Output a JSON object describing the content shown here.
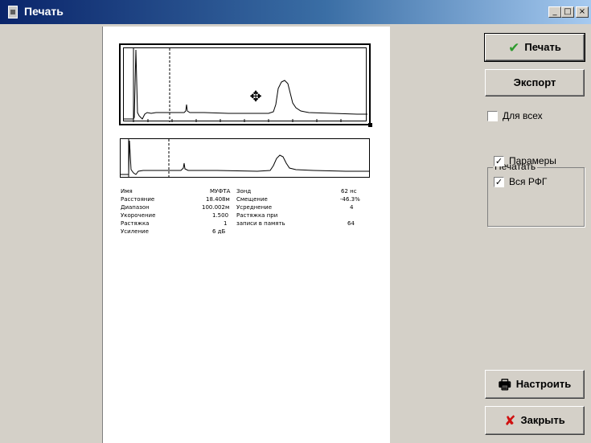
{
  "window": {
    "title": "Печать"
  },
  "caption_buttons": {
    "minimize": "_",
    "maximize": "□",
    "close": "×"
  },
  "preview": {
    "params": [
      {
        "label": "Имя",
        "value": "МУФТА",
        "label2": "Зонд",
        "value2": "62 нс"
      },
      {
        "label": "Расстояние",
        "value": "18.408м",
        "label2": "Смещение",
        "value2": "-46.3%"
      },
      {
        "label": "Диапазон",
        "value": "100.002м",
        "label2": "Усреднение",
        "value2": "4"
      },
      {
        "label": "Укорочение",
        "value": "1.500",
        "label2": "Растяжка при",
        "value2": ""
      },
      {
        "label": "Растяжка",
        "value": "1",
        "label2": "записи в память",
        "value2": "64"
      },
      {
        "label": "Усиление",
        "value": "6 дБ",
        "label2": "",
        "value2": ""
      }
    ]
  },
  "buttons": {
    "print": "Печать",
    "export": "Экспорт",
    "setup": "Настроить",
    "close": "Закрыть"
  },
  "options": {
    "for_all": {
      "label": "Для всех",
      "checked": false
    },
    "group_title": "Печатать",
    "params": {
      "label": "Парамеры",
      "checked": true
    },
    "whole_rfg": {
      "label": "Вся РФГ",
      "checked": true
    }
  },
  "colors": {
    "titlebar_start": "#0a246a",
    "titlebar_end": "#a6caf0",
    "print_check": "#2e9b2e",
    "close_cross": "#d01010"
  }
}
